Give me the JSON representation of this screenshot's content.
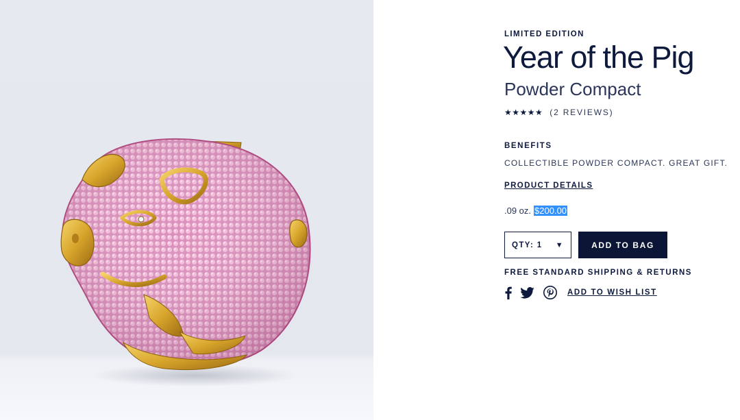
{
  "product": {
    "eyebrow": "LIMITED EDITION",
    "title": "Year of the Pig",
    "subtitle": "Powder Compact",
    "stars": "★★★★★",
    "rating_value": 5,
    "reviews": "(2 REVIEWS)",
    "image_icon": "pig-compact-image"
  },
  "benefits": {
    "heading": "BENEFITS",
    "text": "COLLECTIBLE POWDER COMPACT. GREAT GIFT."
  },
  "details": {
    "link": "PRODUCT DETAILS"
  },
  "pricing": {
    "size": ".09 oz.",
    "price": "$200.00",
    "highlight_color": "#3391ff"
  },
  "purchase": {
    "qty_label": "QTY: 1",
    "qty_arrow": "▼",
    "add_to_bag": "ADD TO BAG",
    "button_color": "#0b1535"
  },
  "shipping": {
    "text": "FREE STANDARD SHIPPING & RETURNS"
  },
  "social": {
    "icons": [
      "facebook-icon",
      "twitter-icon",
      "pinterest-icon"
    ],
    "wish_list": "ADD TO WISH LIST"
  },
  "colors": {
    "navy": "#0e1a3d",
    "image_background": "#e5e8ee",
    "gold": "#d7a52b",
    "pink_crystal": "#f0b2d3"
  }
}
